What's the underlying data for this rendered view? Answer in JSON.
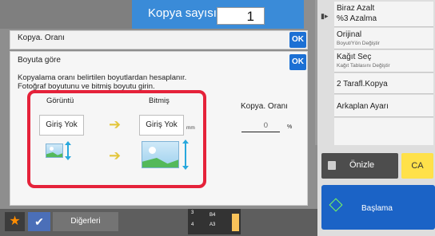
{
  "header": {
    "copy_count_label": "Kopya sayısı",
    "copy_count_value": "1"
  },
  "right_menu": [
    {
      "label": "Biraz Azalt",
      "sub": "%3 Azalma"
    },
    {
      "label": "Orijinal",
      "sub": "Boyut/Yön Değiştir"
    },
    {
      "label": "Kağıt Seç",
      "sub": "Kağıt Tablasını Değiştir"
    },
    {
      "label": "2 Tarafl.Kopya",
      "sub": ""
    },
    {
      "label": "Arkaplan Ayarı",
      "sub": ""
    }
  ],
  "actions": {
    "preview_label": "Önizle",
    "ca_label": "CA",
    "start_label": "Başlama"
  },
  "bottom_bar": {
    "star_icon": "★",
    "check_icon": "✔",
    "others_label": "Diğerleri",
    "tray_lines": [
      "3",
      "B4",
      "4",
      "A3"
    ]
  },
  "dialog": {
    "level1_title": "Kopya. Oranı",
    "level2_title": "Boyuta göre",
    "ok_label": "OK",
    "description_line1": "Kopyalama oranı belirtilen boyutlardan hesaplanır.",
    "description_line2": "Fotoğraf boyutunu ve bitmiş boyutu girin.",
    "image_header": "Görüntü",
    "finish_header": "Bitmiş",
    "image_size_value": "Giriş Yok",
    "finish_size_value": "Giriş Yok",
    "mm_unit": "mm",
    "ratio_label": "Kopya. Oranı",
    "ratio_value": "0",
    "ratio_unit": "%"
  },
  "colors": {
    "accent_blue": "#3a8bd8",
    "ok_blue": "#1c70d4",
    "highlight_red": "#e5223a",
    "start_blue": "#1b63c6",
    "ca_yellow": "#ffe14a"
  }
}
